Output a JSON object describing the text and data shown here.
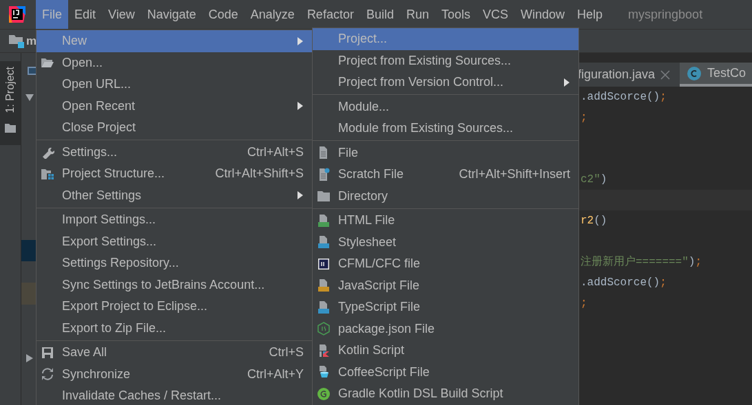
{
  "window": {
    "title": "myspringboot"
  },
  "menu_bar": [
    {
      "label": "File",
      "selected": true
    },
    {
      "label": "Edit",
      "selected": false
    },
    {
      "label": "View",
      "selected": false
    },
    {
      "label": "Navigate",
      "selected": false
    },
    {
      "label": "Code",
      "selected": false
    },
    {
      "label": "Analyze",
      "selected": false
    },
    {
      "label": "Refactor",
      "selected": false
    },
    {
      "label": "Build",
      "selected": false
    },
    {
      "label": "Run",
      "selected": false
    },
    {
      "label": "Tools",
      "selected": false
    },
    {
      "label": "VCS",
      "selected": false
    },
    {
      "label": "Window",
      "selected": false
    },
    {
      "label": "Help",
      "selected": false
    }
  ],
  "navigation_bar": {
    "project": "m"
  },
  "tool_window_stripe": [
    {
      "label": "1: Project",
      "selected": true
    }
  ],
  "file_menu": {
    "groups": [
      {
        "items": [
          {
            "label": "New",
            "selected": true,
            "has_submenu": true
          },
          {
            "label": "Open...",
            "selected": false,
            "has_submenu": false
          },
          {
            "label": "Open URL...",
            "selected": false,
            "has_submenu": false
          },
          {
            "label": "Open Recent",
            "selected": false,
            "has_submenu": true
          },
          {
            "label": "Close Project",
            "selected": false,
            "has_submenu": false
          }
        ]
      },
      {
        "items": [
          {
            "label": "Settings...",
            "shortcut": "Ctrl+Alt+S",
            "selected": false,
            "has_submenu": false
          },
          {
            "label": "Project Structure...",
            "shortcut": "Ctrl+Alt+Shift+S",
            "selected": false,
            "has_submenu": false
          },
          {
            "label": "Other Settings",
            "selected": false,
            "has_submenu": true
          }
        ]
      },
      {
        "items": [
          {
            "label": "Import Settings...",
            "selected": false,
            "has_submenu": false
          },
          {
            "label": "Export Settings...",
            "selected": false,
            "has_submenu": false
          },
          {
            "label": "Settings Repository...",
            "selected": false,
            "has_submenu": false
          },
          {
            "label": "Sync Settings to JetBrains Account...",
            "selected": false,
            "has_submenu": false
          },
          {
            "label": "Export Project to Eclipse...",
            "selected": false,
            "has_submenu": false
          },
          {
            "label": "Export to Zip File...",
            "selected": false,
            "has_submenu": false
          }
        ]
      },
      {
        "items": [
          {
            "label": "Save All",
            "shortcut": "Ctrl+S",
            "selected": false,
            "has_submenu": false
          },
          {
            "label": "Synchronize",
            "shortcut": "Ctrl+Alt+Y",
            "selected": false,
            "has_submenu": false
          },
          {
            "label": "Invalidate Caches / Restart...",
            "selected": false,
            "has_submenu": false
          }
        ]
      }
    ]
  },
  "new_submenu": {
    "groups": [
      {
        "items": [
          {
            "label": "Project...",
            "selected": true,
            "has_submenu": false
          },
          {
            "label": "Project from Existing Sources...",
            "selected": false,
            "has_submenu": false
          },
          {
            "label": "Project from Version Control...",
            "selected": false,
            "has_submenu": true
          }
        ]
      },
      {
        "items": [
          {
            "label": "Module...",
            "selected": false,
            "has_submenu": false
          },
          {
            "label": "Module from Existing Sources...",
            "selected": false,
            "has_submenu": false
          }
        ]
      },
      {
        "items": [
          {
            "label": "File",
            "selected": false,
            "has_submenu": false
          },
          {
            "label": "Scratch File",
            "shortcut": "Ctrl+Alt+Shift+Insert",
            "selected": false,
            "has_submenu": false
          },
          {
            "label": "Directory",
            "selected": false,
            "has_submenu": false
          }
        ]
      },
      {
        "items": [
          {
            "label": "HTML File",
            "selected": false,
            "has_submenu": false
          },
          {
            "label": "Stylesheet",
            "selected": false,
            "has_submenu": false
          },
          {
            "label": "CFML/CFC file",
            "selected": false,
            "has_submenu": false
          },
          {
            "label": "JavaScript File",
            "selected": false,
            "has_submenu": false
          },
          {
            "label": "TypeScript File",
            "selected": false,
            "has_submenu": false
          },
          {
            "label": "package.json File",
            "selected": false,
            "has_submenu": false
          },
          {
            "label": "Kotlin Script",
            "selected": false,
            "has_submenu": false
          },
          {
            "label": "CoffeeScript File",
            "selected": false,
            "has_submenu": false
          },
          {
            "label": "Gradle Kotlin DSL Build Script",
            "selected": false,
            "has_submenu": false
          }
        ]
      }
    ]
  },
  "editor": {
    "tabs": [
      {
        "label": "figuration.java",
        "selected": false,
        "closable": true
      },
      {
        "label": "TestCo",
        "selected": true,
        "closable": false
      }
    ],
    "lines": [
      {
        "kind": "code",
        "tokens": [
          {
            "kind": "plain",
            "text": ".addScorce()"
          },
          {
            "kind": "keyword",
            "text": ";"
          }
        ]
      },
      {
        "kind": "code",
        "tokens": [
          {
            "kind": "keyword",
            "text": ";"
          }
        ]
      },
      {
        "kind": "blank"
      },
      {
        "kind": "blank"
      },
      {
        "kind": "code",
        "tokens": [
          {
            "kind": "string",
            "text": "c2\""
          },
          {
            "kind": "plain",
            "text": ")"
          }
        ]
      },
      {
        "kind": "caret"
      },
      {
        "kind": "code",
        "tokens": [
          {
            "kind": "method",
            "text": "r2"
          },
          {
            "kind": "plain",
            "text": "()"
          }
        ]
      },
      {
        "kind": "blank"
      },
      {
        "kind": "code",
        "tokens": [
          {
            "kind": "string",
            "text": "注册新用户=======\""
          },
          {
            "kind": "plain",
            "text": ")"
          },
          {
            "kind": "keyword",
            "text": ";"
          }
        ]
      },
      {
        "kind": "code",
        "tokens": [
          {
            "kind": "plain",
            "text": ".addScorce()"
          },
          {
            "kind": "keyword",
            "text": ";"
          }
        ]
      },
      {
        "kind": "code",
        "tokens": [
          {
            "kind": "keyword",
            "text": ";"
          }
        ]
      }
    ]
  }
}
